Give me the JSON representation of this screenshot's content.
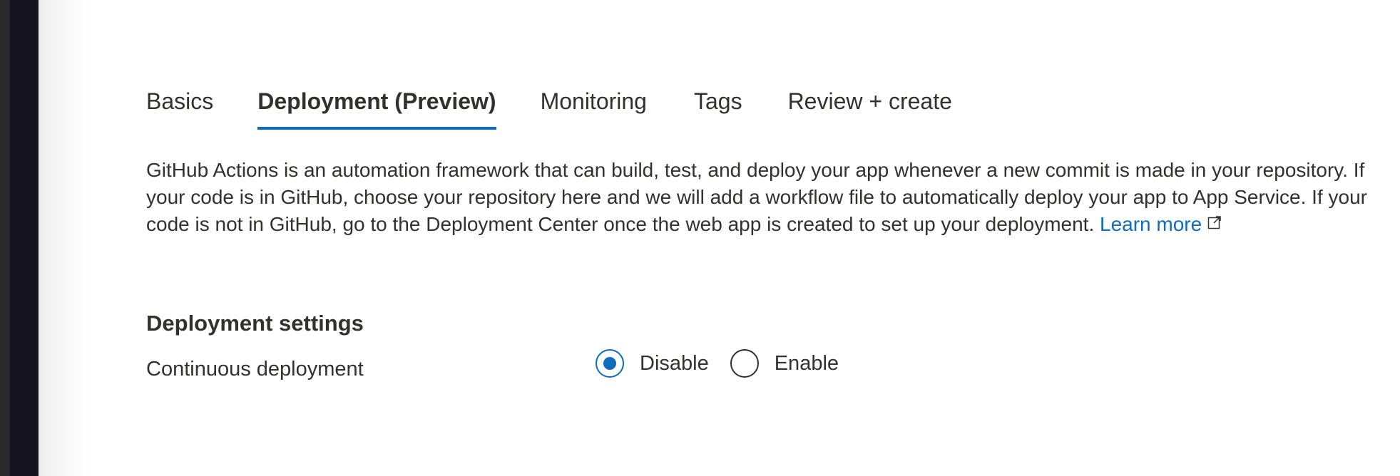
{
  "tabs": [
    {
      "label": "Basics",
      "active": false
    },
    {
      "label": "Deployment (Preview)",
      "active": true
    },
    {
      "label": "Monitoring",
      "active": false
    },
    {
      "label": "Tags",
      "active": false
    },
    {
      "label": "Review + create",
      "active": false
    }
  ],
  "description": {
    "text": "GitHub Actions is an automation framework that can build, test, and deploy your app whenever a new commit is made in your repository. If your code is in GitHub, choose your repository here and we will add a workflow file to automatically deploy your app to App Service. If your code is not in GitHub, go to the Deployment Center once the web app is created to set up your deployment.",
    "link_label": "Learn more",
    "link_icon": "external-link-icon"
  },
  "deployment_settings": {
    "title": "Deployment settings",
    "continuous_deployment": {
      "label": "Continuous deployment",
      "options": [
        {
          "label": "Disable",
          "checked": true
        },
        {
          "label": "Enable",
          "checked": false
        }
      ]
    }
  },
  "colors": {
    "accent": "#0f6cbd",
    "text": "#323130",
    "sidebar": "#15131f"
  }
}
